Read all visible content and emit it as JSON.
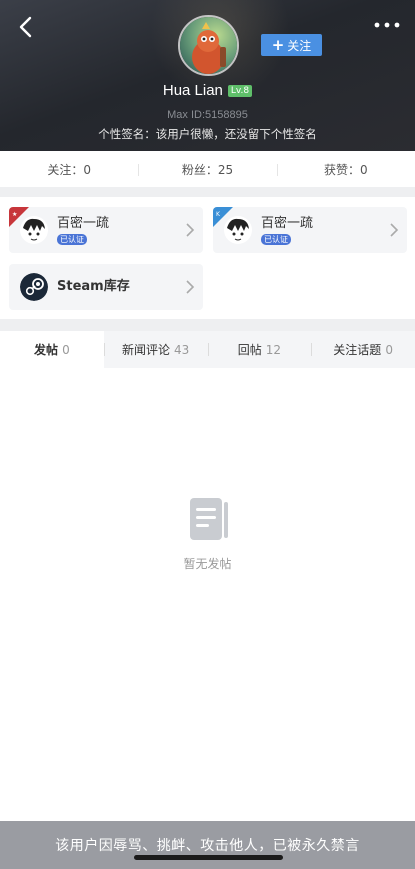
{
  "header": {
    "username": "Hua Lian",
    "level": "Lv.8",
    "max_id": "Max ID:5158895",
    "signature": "个性签名：该用户很懒，还没留下个性签名",
    "follow_label": "关注"
  },
  "stats": [
    {
      "label": "关注：0"
    },
    {
      "label": "粉丝：25"
    },
    {
      "label": "获赞：0"
    }
  ],
  "cards": [
    {
      "title": "百密一疏",
      "badge": "已认证",
      "icon": "anime-avatar-icon",
      "corner_color": "#c7363b"
    },
    {
      "title": "百密一疏",
      "badge": "已认证",
      "icon": "anime-avatar-icon",
      "corner_color": "#3a8fd6"
    },
    {
      "title": "Steam库存",
      "icon": "steam-icon"
    }
  ],
  "tabs": [
    {
      "label": "发帖",
      "count": "0",
      "active": true
    },
    {
      "label": "新闻评论",
      "count": "43"
    },
    {
      "label": "回帖",
      "count": "12"
    },
    {
      "label": "关注话题",
      "count": "0"
    }
  ],
  "empty_state": {
    "text": "暂无发帖",
    "icon": "document-icon"
  },
  "ban_notice": "该用户因辱骂、挑衅、攻击他人，已被永久禁言",
  "colors": {
    "accent": "#4a90e2",
    "level": "#5fbf6a",
    "banner": "#9a9ca2"
  }
}
